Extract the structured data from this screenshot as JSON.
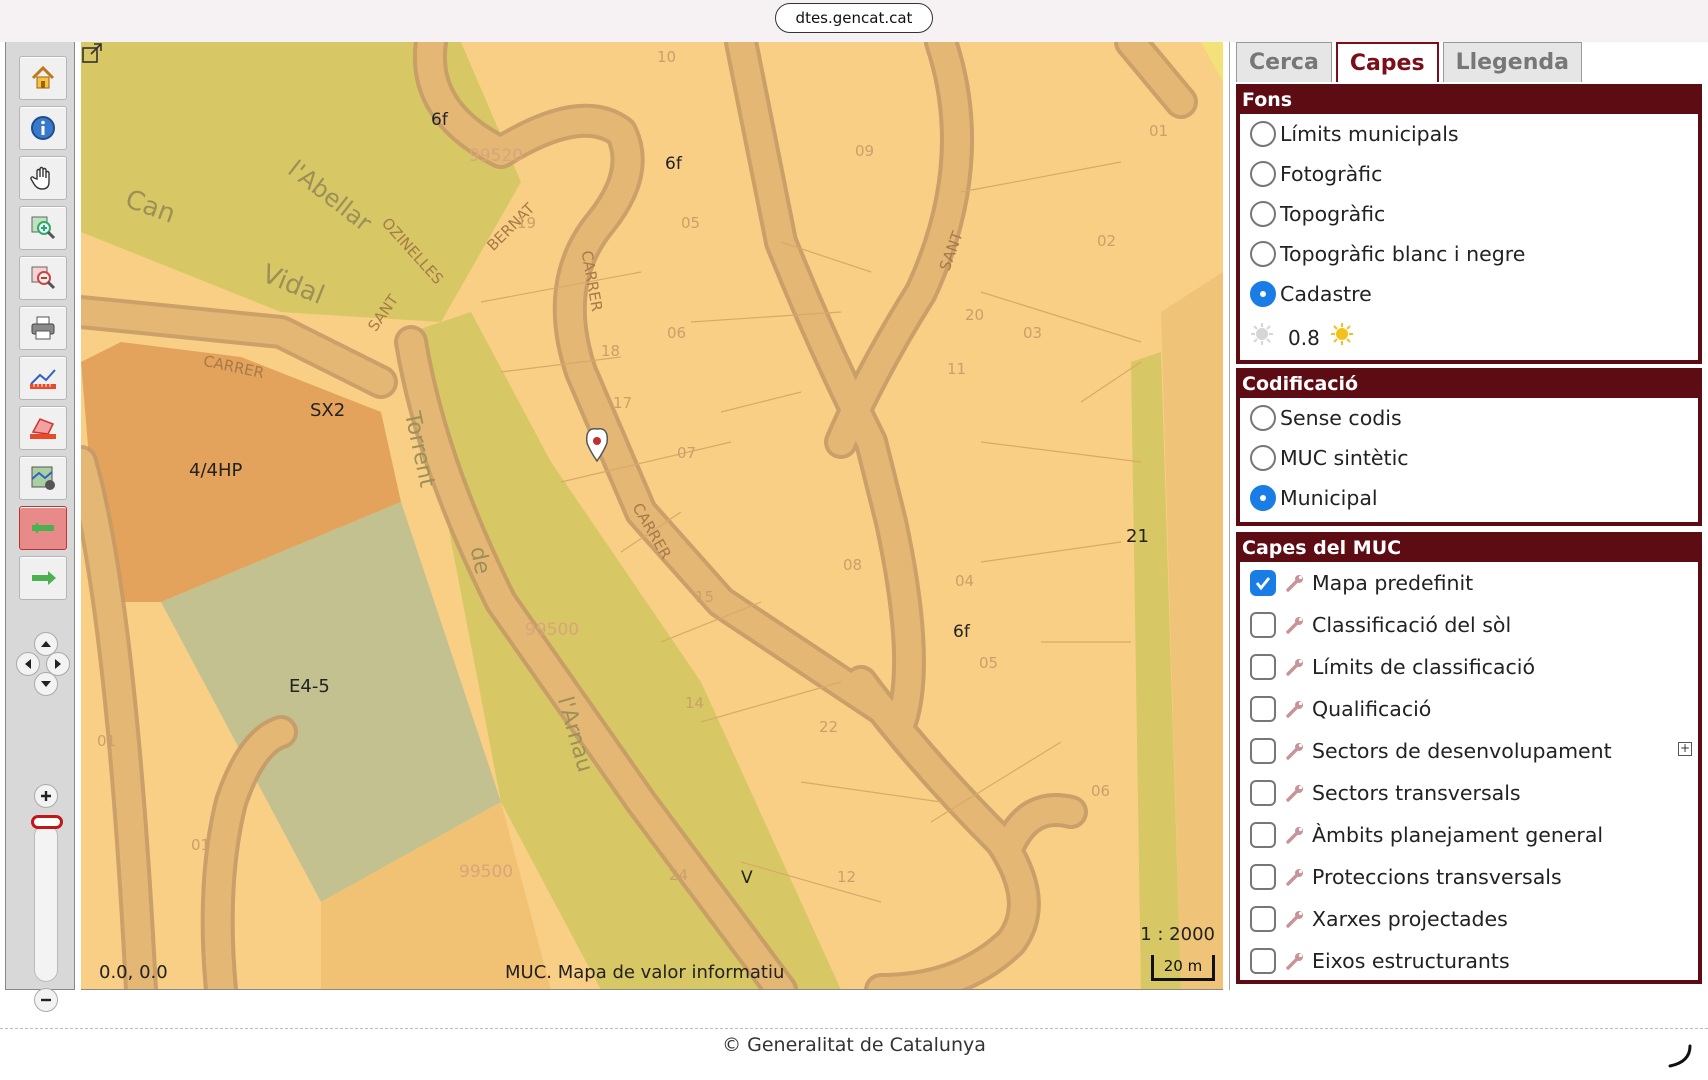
{
  "browser": {
    "url": "dtes.gencat.cat"
  },
  "toolbar": {
    "tools": [
      {
        "name": "home-button",
        "icon": "home-icon",
        "active": false
      },
      {
        "name": "info-button",
        "icon": "info-icon",
        "active": false
      },
      {
        "name": "pan-button",
        "icon": "hand-icon",
        "active": false
      },
      {
        "name": "zoom-in-tool-button",
        "icon": "zoom-in-icon",
        "active": false
      },
      {
        "name": "zoom-out-tool-button",
        "icon": "zoom-out-icon",
        "active": false
      },
      {
        "name": "print-button",
        "icon": "printer-icon",
        "active": false
      },
      {
        "name": "measure-distance-button",
        "icon": "ruler-icon",
        "active": false
      },
      {
        "name": "measure-area-button",
        "icon": "area-icon",
        "active": false
      },
      {
        "name": "map-export-button",
        "icon": "map-export-icon",
        "active": false
      },
      {
        "name": "previous-view-button",
        "icon": "arrow-left-icon",
        "active": true
      },
      {
        "name": "next-view-button",
        "icon": "arrow-right-icon",
        "active": false
      }
    ]
  },
  "map": {
    "coords": "0.0, 0.0",
    "credit": "MUC. Mapa de valor informatiu",
    "scale_ratio": "1 : 2000",
    "scale_bar": "20 m",
    "labels": {
      "zone_a": "4/4HP",
      "zone_b": "E4-5",
      "zone_c": "SX2",
      "zone_d": "21",
      "zone_e": "6f",
      "zone_f": "6f",
      "zone_g": "6f",
      "zone_h": "V",
      "place_can": "Can",
      "place_vidal": "Vidal",
      "place_abellar": "l'Abellar",
      "torrent_1": "Torrent",
      "torrent_2": "de",
      "torrent_3": "l'Arnau",
      "street_carrer_sant": "CARRER",
      "street_sant": "SANT",
      "street_bernat": "BERNAT",
      "street_ozinelles": "OZINELLES",
      "street_carrer2": "CARRER",
      "street_carrer3": "CARRER",
      "street_sant2": "SANT",
      "parcel_10": "10",
      "parcel_19": "19",
      "parcel_05": "05",
      "parcel_09": "09",
      "parcel_06": "06",
      "parcel_18": "18",
      "parcel_17": "17",
      "parcel_07": "07",
      "parcel_08": "08",
      "parcel_15": "15",
      "parcel_14": "14",
      "parcel_22": "22",
      "parcel_24": "24",
      "parcel_12": "12",
      "parcel_04": "04",
      "parcel_01a": "01",
      "parcel_01b": "01",
      "parcel_02": "02",
      "parcel_03": "03",
      "parcel_11": "11",
      "parcel_20": "20",
      "parcel_06b": "06",
      "parcel_05b": "05",
      "parcel_01c": "01",
      "parcel_99520": "99520",
      "parcel_99500": "99500",
      "parcel_99500b": "99500"
    }
  },
  "panel": {
    "tabs": [
      {
        "label": "Cerca",
        "active": false
      },
      {
        "label": "Capes",
        "active": true
      },
      {
        "label": "Llegenda",
        "active": false
      }
    ],
    "fons": {
      "title": "Fons",
      "options": [
        {
          "label": "Límits municipals",
          "selected": false
        },
        {
          "label": "Fotogràfic",
          "selected": false
        },
        {
          "label": "Topogràfic",
          "selected": false
        },
        {
          "label": "Topogràfic blanc i negre",
          "selected": false
        },
        {
          "label": "Cadastre",
          "selected": true
        }
      ],
      "opacity": "0.8"
    },
    "codificacio": {
      "title": "Codificació",
      "options": [
        {
          "label": "Sense codis",
          "selected": false
        },
        {
          "label": "MUC sintètic",
          "selected": false
        },
        {
          "label": "Municipal",
          "selected": true
        }
      ]
    },
    "capes": {
      "title": "Capes del MUC",
      "layers": [
        {
          "label": "Mapa predefinit",
          "checked": true
        },
        {
          "label": "Classificació del sòl",
          "checked": false
        },
        {
          "label": "Límits de classificació",
          "checked": false
        },
        {
          "label": "Qualificació",
          "checked": false
        },
        {
          "label": "Sectors de desenvolupament",
          "checked": false,
          "expand": "+"
        },
        {
          "label": "Sectors transversals",
          "checked": false
        },
        {
          "label": "Àmbits planejament general",
          "checked": false
        },
        {
          "label": "Proteccions transversals",
          "checked": false
        },
        {
          "label": "Xarxes projectades",
          "checked": false
        },
        {
          "label": "Eixos estructurants",
          "checked": false
        }
      ]
    }
  },
  "footer": {
    "text": "© Generalitat de Catalunya"
  },
  "colors": {
    "accent": "#5e0c13",
    "radio_selected": "#1a7de6",
    "map_base": "#f8cf85",
    "map_road": "#deb47a",
    "zone_green": "#d8c765",
    "zone_orange": "#e3a35c",
    "zone_gray_green": "#c3c190"
  }
}
